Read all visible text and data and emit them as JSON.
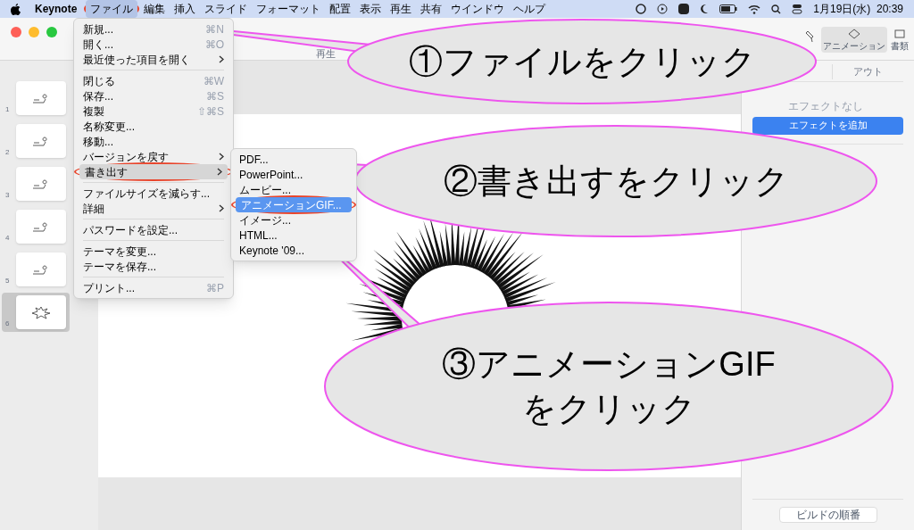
{
  "menubar": {
    "app": "Keynote",
    "items": [
      {
        "label": "ファイル",
        "selected": true,
        "circled": true
      },
      {
        "label": "編集",
        "selected": false,
        "circled": false
      },
      {
        "label": "挿入",
        "selected": false,
        "circled": false
      },
      {
        "label": "スライド",
        "selected": false,
        "circled": false
      },
      {
        "label": "フォーマット",
        "selected": false,
        "circled": false
      },
      {
        "label": "配置",
        "selected": false,
        "circled": false
      },
      {
        "label": "表示",
        "selected": false,
        "circled": false
      },
      {
        "label": "再生",
        "selected": false,
        "circled": false
      },
      {
        "label": "共有",
        "selected": false,
        "circled": false
      },
      {
        "label": "ウインドウ",
        "selected": false,
        "circled": false
      },
      {
        "label": "ヘルプ",
        "selected": false,
        "circled": false
      }
    ],
    "clock": "1月19日(水)  20:39"
  },
  "toolbar": {
    "play_label": "再生"
  },
  "file_menu": [
    {
      "kind": "item",
      "label": "新規...",
      "shortcut": "⌘N",
      "submenu": false,
      "selected": false,
      "circled": false
    },
    {
      "kind": "item",
      "label": "開く...",
      "shortcut": "⌘O",
      "submenu": false,
      "selected": false,
      "circled": false
    },
    {
      "kind": "item",
      "label": "最近使った項目を開く",
      "submenu": true,
      "selected": false,
      "circled": false
    },
    {
      "kind": "separator"
    },
    {
      "kind": "item",
      "label": "閉じる",
      "shortcut": "⌘W",
      "submenu": false,
      "selected": false,
      "circled": false
    },
    {
      "kind": "item",
      "label": "保存...",
      "shortcut": "⌘S",
      "submenu": false,
      "selected": false,
      "circled": false
    },
    {
      "kind": "item",
      "label": "複製",
      "shortcut": "⇧⌘S",
      "submenu": false,
      "selected": false,
      "circled": false
    },
    {
      "kind": "item",
      "label": "名称変更...",
      "submenu": false,
      "selected": false,
      "circled": false
    },
    {
      "kind": "item",
      "label": "移動...",
      "submenu": false,
      "selected": false,
      "circled": false
    },
    {
      "kind": "item",
      "label": "バージョンを戻す",
      "submenu": true,
      "selected": false,
      "circled": false
    },
    {
      "kind": "item",
      "label": "書き出す",
      "submenu": true,
      "selected": true,
      "circled": true
    },
    {
      "kind": "separator"
    },
    {
      "kind": "item",
      "label": "ファイルサイズを減らす...",
      "submenu": false,
      "selected": false,
      "circled": false
    },
    {
      "kind": "item",
      "label": "詳細",
      "submenu": true,
      "selected": false,
      "circled": false
    },
    {
      "kind": "separator"
    },
    {
      "kind": "item",
      "label": "パスワードを設定...",
      "submenu": false,
      "selected": false,
      "circled": false
    },
    {
      "kind": "separator"
    },
    {
      "kind": "item",
      "label": "テーマを変更...",
      "submenu": false,
      "selected": false,
      "circled": false
    },
    {
      "kind": "item",
      "label": "テーマを保存...",
      "submenu": false,
      "selected": false,
      "circled": false
    },
    {
      "kind": "separator"
    },
    {
      "kind": "item",
      "label": "プリント...",
      "shortcut": "⌘P",
      "submenu": false,
      "selected": false,
      "circled": false
    }
  ],
  "export_menu": [
    {
      "label": "PDF...",
      "selected": false,
      "circled": false
    },
    {
      "label": "PowerPoint...",
      "selected": false,
      "circled": false
    },
    {
      "label": "ムービー...",
      "selected": false,
      "circled": false
    },
    {
      "label": "アニメーションGIF...",
      "selected": true,
      "circled": true
    },
    {
      "label": "イメージ...",
      "selected": false,
      "circled": false
    },
    {
      "label": "HTML...",
      "selected": false,
      "circled": false
    },
    {
      "label": "Keynote '09...",
      "selected": false,
      "circled": false
    }
  ],
  "slides": [
    {
      "number": "1",
      "selected": false
    },
    {
      "number": "2",
      "selected": false
    },
    {
      "number": "3",
      "selected": false
    },
    {
      "number": "4",
      "selected": false
    },
    {
      "number": "5",
      "selected": false
    },
    {
      "number": "6",
      "selected": true
    }
  ],
  "inspector": {
    "tabs": [
      {
        "label": "アニメーション",
        "selected": true
      },
      {
        "label": "書類",
        "selected": false
      }
    ],
    "segment": "アウト",
    "empty_label": "エフェクトなし",
    "add_button": "エフェクトを追加",
    "order_button": "ビルドの順番"
  },
  "callouts": [
    {
      "lines": [
        "①ファイルをクリック"
      ]
    },
    {
      "lines": [
        "②書き出すをクリック"
      ]
    },
    {
      "lines": [
        "③アニメーションGIF",
        "をクリック"
      ]
    }
  ]
}
